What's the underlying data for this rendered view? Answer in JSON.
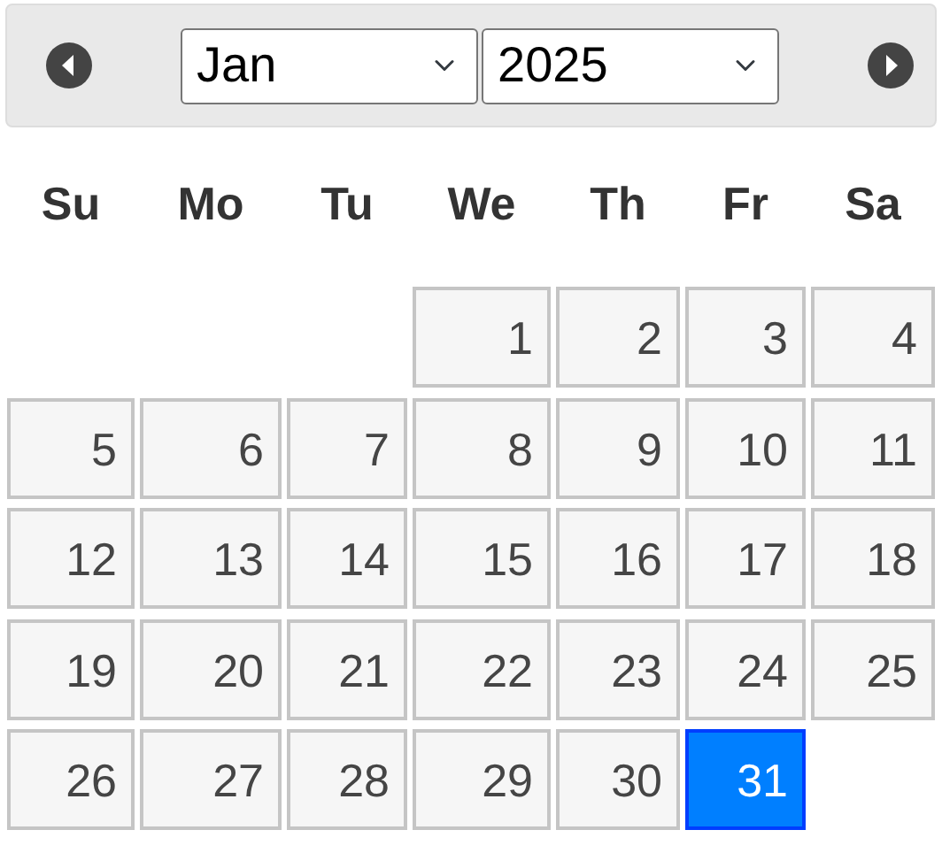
{
  "header": {
    "month": "Jan",
    "year": "2025"
  },
  "weekdays": [
    "Su",
    "Mo",
    "Tu",
    "We",
    "Th",
    "Fr",
    "Sa"
  ],
  "weeks": [
    [
      {
        "kind": "empty"
      },
      {
        "kind": "empty"
      },
      {
        "kind": "empty"
      },
      {
        "kind": "day",
        "label": "1",
        "selected": false
      },
      {
        "kind": "day",
        "label": "2",
        "selected": false
      },
      {
        "kind": "day",
        "label": "3",
        "selected": false
      },
      {
        "kind": "day",
        "label": "4",
        "selected": false
      }
    ],
    [
      {
        "kind": "day",
        "label": "5",
        "selected": false
      },
      {
        "kind": "day",
        "label": "6",
        "selected": false
      },
      {
        "kind": "day",
        "label": "7",
        "selected": false
      },
      {
        "kind": "day",
        "label": "8",
        "selected": false
      },
      {
        "kind": "day",
        "label": "9",
        "selected": false
      },
      {
        "kind": "day",
        "label": "10",
        "selected": false
      },
      {
        "kind": "day",
        "label": "11",
        "selected": false
      }
    ],
    [
      {
        "kind": "day",
        "label": "12",
        "selected": false
      },
      {
        "kind": "day",
        "label": "13",
        "selected": false
      },
      {
        "kind": "day",
        "label": "14",
        "selected": false
      },
      {
        "kind": "day",
        "label": "15",
        "selected": false
      },
      {
        "kind": "day",
        "label": "16",
        "selected": false
      },
      {
        "kind": "day",
        "label": "17",
        "selected": false
      },
      {
        "kind": "day",
        "label": "18",
        "selected": false
      }
    ],
    [
      {
        "kind": "day",
        "label": "19",
        "selected": false
      },
      {
        "kind": "day",
        "label": "20",
        "selected": false
      },
      {
        "kind": "day",
        "label": "21",
        "selected": false
      },
      {
        "kind": "day",
        "label": "22",
        "selected": false
      },
      {
        "kind": "day",
        "label": "23",
        "selected": false
      },
      {
        "kind": "day",
        "label": "24",
        "selected": false
      },
      {
        "kind": "day",
        "label": "25",
        "selected": false
      }
    ],
    [
      {
        "kind": "day",
        "label": "26",
        "selected": false
      },
      {
        "kind": "day",
        "label": "27",
        "selected": false
      },
      {
        "kind": "day",
        "label": "28",
        "selected": false
      },
      {
        "kind": "day",
        "label": "29",
        "selected": false
      },
      {
        "kind": "day",
        "label": "30",
        "selected": false
      },
      {
        "kind": "day",
        "label": "31",
        "selected": true
      },
      {
        "kind": "empty"
      }
    ]
  ]
}
